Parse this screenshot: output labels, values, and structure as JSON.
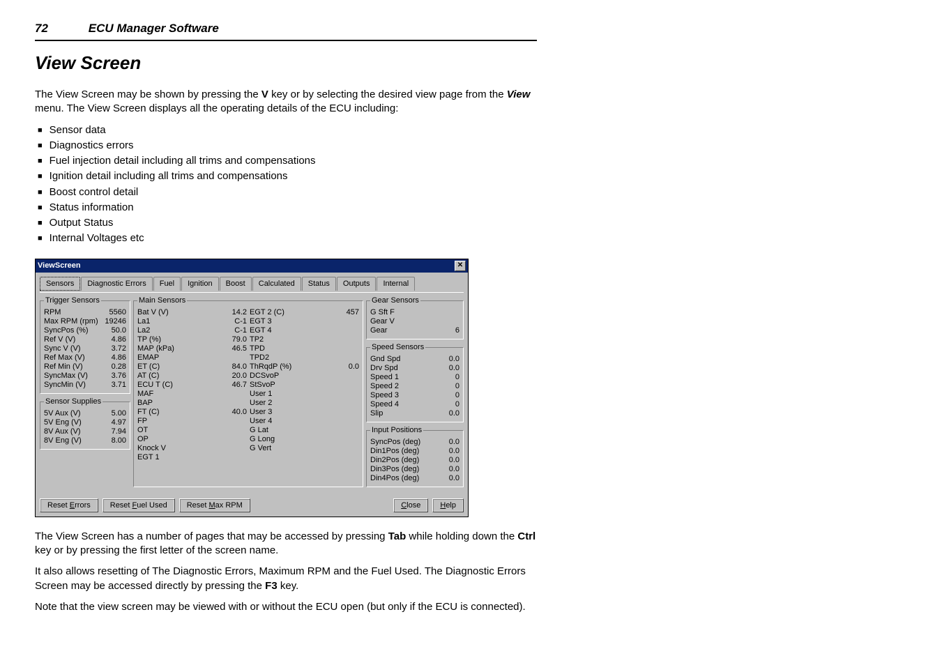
{
  "header": {
    "page_number": "72",
    "section": "ECU Manager Software"
  },
  "title": "View Screen",
  "intro": {
    "p1_a": "The View Screen may be shown by pressing the ",
    "p1_key": "V",
    "p1_b": " key or by selecting the desired view page from the ",
    "p1_menu": "View",
    "p1_c": " menu. The View Screen displays all the operating details of the ECU including:"
  },
  "bullets": [
    "Sensor data",
    "Diagnostics errors",
    "Fuel injection detail including all trims and compensations",
    "Ignition detail including all trims and compensations",
    "Boost control detail",
    "Status information",
    "Output Status",
    "Internal Voltages etc"
  ],
  "dialog": {
    "title": "ViewScreen",
    "tabs": [
      "Sensors",
      "Diagnostic Errors",
      "Fuel",
      "Ignition",
      "Boost",
      "Calculated",
      "Status",
      "Outputs",
      "Internal"
    ],
    "groups": {
      "trigger": {
        "legend": "Trigger Sensors",
        "rows": [
          {
            "l": "RPM",
            "v": "5560"
          },
          {
            "l": "Max RPM (rpm)",
            "v": "19246"
          },
          {
            "l": "SyncPos (%)",
            "v": "50.0"
          },
          {
            "l": "Ref V (V)",
            "v": "4.86"
          },
          {
            "l": "Sync V (V)",
            "v": "3.72"
          },
          {
            "l": "Ref Max (V)",
            "v": "4.86"
          },
          {
            "l": "Ref Min (V)",
            "v": "0.28"
          },
          {
            "l": "SyncMax (V)",
            "v": "3.76"
          },
          {
            "l": "SyncMin (V)",
            "v": "3.71"
          }
        ]
      },
      "supplies": {
        "legend": "Sensor Supplies",
        "rows": [
          {
            "l": "5V Aux (V)",
            "v": "5.00"
          },
          {
            "l": "5V Eng (V)",
            "v": "4.97"
          },
          {
            "l": "8V Aux (V)",
            "v": "7.94"
          },
          {
            "l": "8V Eng (V)",
            "v": "8.00"
          }
        ]
      },
      "main": {
        "legend": "Main Sensors",
        "left": [
          {
            "l": "Bat V (V)",
            "v": "14.2"
          },
          {
            "l": "La1",
            "v": "C-1"
          },
          {
            "l": "La2",
            "v": "C-1"
          },
          {
            "l": "TP (%)",
            "v": "79.0"
          },
          {
            "l": "MAP (kPa)",
            "v": "46.5"
          },
          {
            "l": "EMAP",
            "v": ""
          },
          {
            "l": "ET (C)",
            "v": "84.0"
          },
          {
            "l": "AT (C)",
            "v": "20.0"
          },
          {
            "l": "ECU T (C)",
            "v": "46.7"
          },
          {
            "l": "MAF",
            "v": ""
          },
          {
            "l": "BAP",
            "v": ""
          },
          {
            "l": "FT (C)",
            "v": "40.0"
          },
          {
            "l": "FP",
            "v": ""
          },
          {
            "l": "OT",
            "v": ""
          },
          {
            "l": "OP",
            "v": ""
          },
          {
            "l": "Knock V",
            "v": ""
          },
          {
            "l": "EGT 1",
            "v": ""
          }
        ],
        "right": [
          {
            "l": "EGT 2 (C)",
            "v": "457"
          },
          {
            "l": "EGT 3",
            "v": ""
          },
          {
            "l": "EGT 4",
            "v": ""
          },
          {
            "l": "TP2",
            "v": ""
          },
          {
            "l": "TPD",
            "v": ""
          },
          {
            "l": "TPD2",
            "v": ""
          },
          {
            "l": "ThRqdP (%)",
            "v": "0.0"
          },
          {
            "l": "DCSvoP",
            "v": ""
          },
          {
            "l": "StSvoP",
            "v": ""
          },
          {
            "l": "User 1",
            "v": ""
          },
          {
            "l": "User 2",
            "v": ""
          },
          {
            "l": "User 3",
            "v": ""
          },
          {
            "l": "User 4",
            "v": ""
          },
          {
            "l": "G Lat",
            "v": ""
          },
          {
            "l": "G Long",
            "v": ""
          },
          {
            "l": "G Vert",
            "v": ""
          }
        ]
      },
      "gear": {
        "legend": "Gear Sensors",
        "rows": [
          {
            "l": "G Sft F",
            "v": ""
          },
          {
            "l": "Gear V",
            "v": ""
          },
          {
            "l": "Gear",
            "v": "6"
          }
        ]
      },
      "speed": {
        "legend": "Speed Sensors",
        "rows": [
          {
            "l": "Gnd Spd",
            "v": "0.0"
          },
          {
            "l": "Drv Spd",
            "v": "0.0"
          },
          {
            "l": "Speed 1",
            "v": "0"
          },
          {
            "l": "Speed 2",
            "v": "0"
          },
          {
            "l": "Speed 3",
            "v": "0"
          },
          {
            "l": "Speed 4",
            "v": "0"
          },
          {
            "l": "Slip",
            "v": "0.0"
          }
        ]
      },
      "input": {
        "legend": "Input Positions",
        "rows": [
          {
            "l": "SyncPos (deg)",
            "v": "0.0"
          },
          {
            "l": "Din1Pos (deg)",
            "v": "0.0"
          },
          {
            "l": "Din2Pos (deg)",
            "v": "0.0"
          },
          {
            "l": "Din3Pos (deg)",
            "v": "0.0"
          },
          {
            "l": "Din4Pos (deg)",
            "v": "0.0"
          }
        ]
      }
    },
    "buttons": {
      "reset_errors_pre": "Reset ",
      "reset_errors_u": "E",
      "reset_errors_post": "rrors",
      "reset_fuel_pre": "Reset ",
      "reset_fuel_u": "F",
      "reset_fuel_post": "uel Used",
      "reset_rpm_pre": "Reset ",
      "reset_rpm_u": "M",
      "reset_rpm_post": "ax RPM",
      "close_u": "C",
      "close_post": "lose",
      "help_u": "H",
      "help_post": "elp"
    }
  },
  "after": {
    "p2_a": "The View Screen has a number of pages that may be accessed by pressing ",
    "p2_tab": "Tab",
    "p2_b": " while holding down the ",
    "p2_ctrl": "Ctrl",
    "p2_c": " key or by pressing the first letter of the screen name.",
    "p3_a": "It also allows resetting of The Diagnostic Errors, Maximum RPM and the Fuel Used. The Diagnostic Errors Screen may be accessed directly by pressing the ",
    "p3_key": "F3",
    "p3_b": " key.",
    "p4": "Note that the view screen may be viewed with or without the ECU open (but only if the ECU is connected)."
  }
}
